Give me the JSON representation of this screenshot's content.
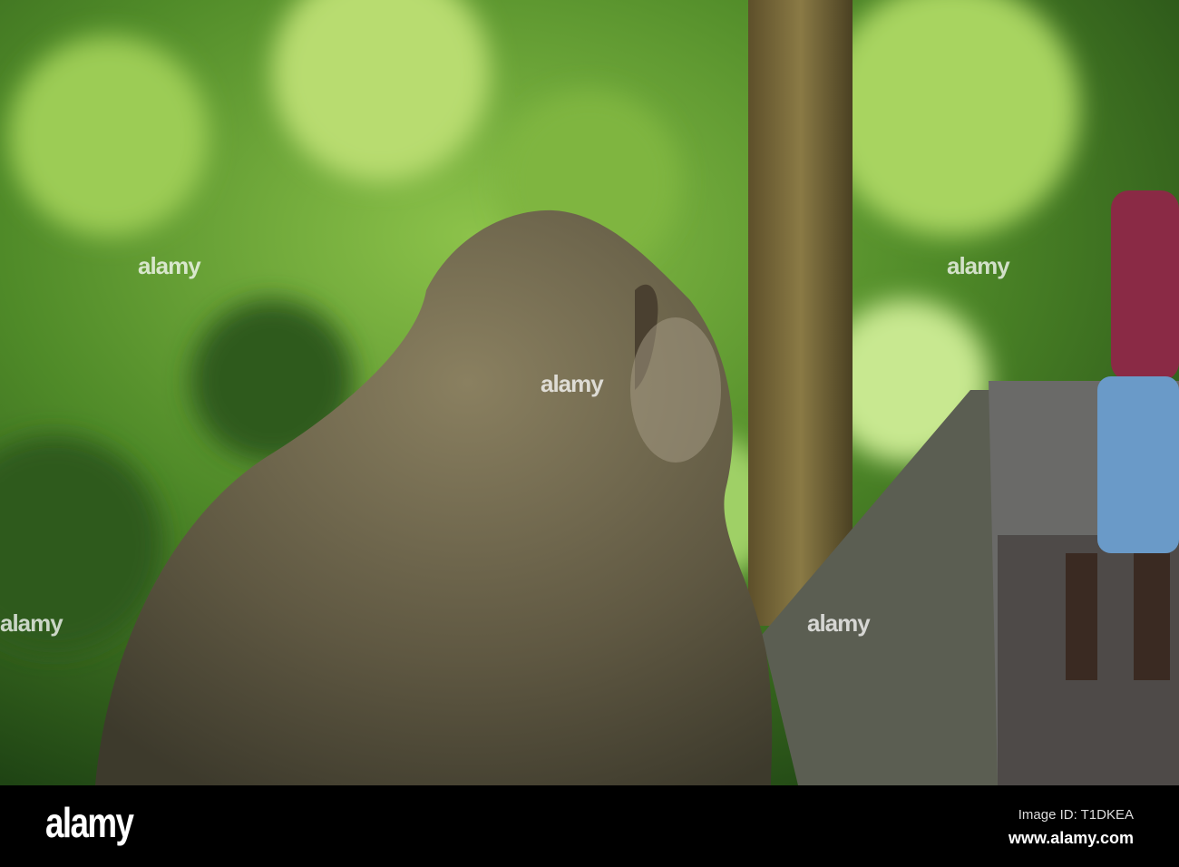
{
  "watermark": {
    "text": "alamy"
  },
  "footer": {
    "logo": "alamy",
    "image_id": "Image ID: T1DKEA",
    "website": "www.alamy.com"
  }
}
